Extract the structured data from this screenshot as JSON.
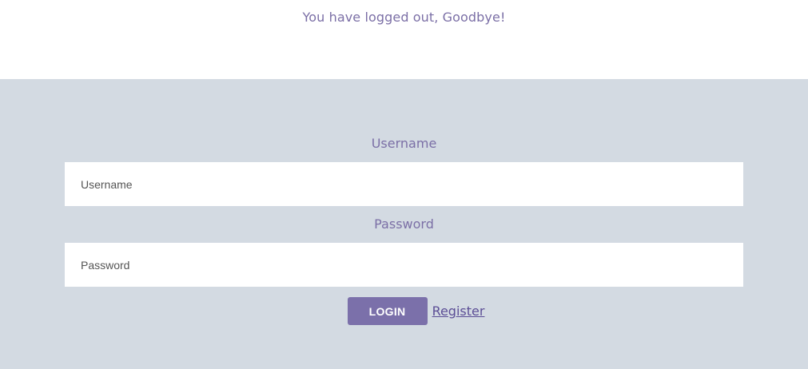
{
  "header": {
    "logout_message": "You have logged out, Goodbye!"
  },
  "login_form": {
    "username_label": "Username",
    "username_placeholder": "Username",
    "username_value": "",
    "password_label": "Password",
    "password_placeholder": "Password",
    "password_value": "",
    "login_button_label": "LOGIN",
    "register_link_label": "Register"
  },
  "colors": {
    "accent": "#7b70aa",
    "label_text": "#7b6fa6",
    "link": "#5c4e96",
    "form_background": "#d3dae2"
  }
}
